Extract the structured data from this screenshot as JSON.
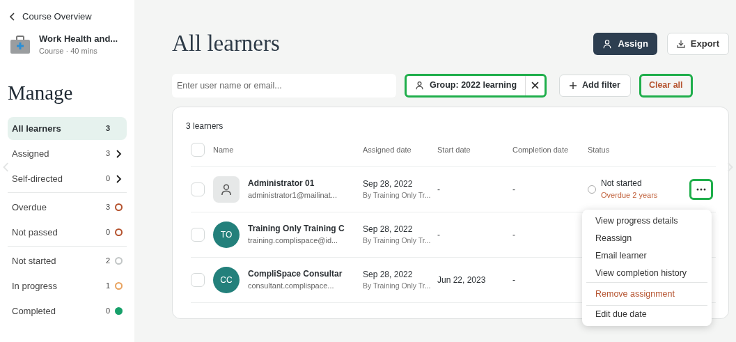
{
  "back_link": "Course Overview",
  "course": {
    "title": "Work Health and...",
    "meta": "Course · 40 mins"
  },
  "sidebar_title": "Manage",
  "sidebar_sections": [
    [
      {
        "label": "All learners",
        "count": "3",
        "kind": "plain",
        "selected": true
      },
      {
        "label": "Assigned",
        "count": "3",
        "kind": "link",
        "selected": false
      },
      {
        "label": "Self-directed",
        "count": "0",
        "kind": "link",
        "selected": false
      }
    ],
    [
      {
        "label": "Overdue",
        "count": "3",
        "kind": "ring",
        "color": "#b5532f",
        "selected": false
      },
      {
        "label": "Not passed",
        "count": "0",
        "kind": "ring",
        "color": "#b5532f",
        "selected": false
      }
    ],
    [
      {
        "label": "Not started",
        "count": "2",
        "kind": "ring",
        "color": "#c2c6c6",
        "selected": false
      },
      {
        "label": "In progress",
        "count": "1",
        "kind": "ring",
        "color": "#e8a25e",
        "selected": false
      },
      {
        "label": "Completed",
        "count": "0",
        "kind": "dot",
        "color": "#17a06a",
        "selected": false
      }
    ]
  ],
  "page_title": "All learners",
  "actions": [
    {
      "label": "Assign",
      "kind": "primary"
    },
    {
      "label": "Export",
      "kind": "secondary"
    }
  ],
  "search": {
    "placeholder": "Enter user name or email..."
  },
  "filter_chip": {
    "label": "Group: 2022 learning",
    "highlighted": true
  },
  "add_filter": "Add filter",
  "clear_all": {
    "label": "Clear all",
    "highlighted": true
  },
  "table": {
    "count": "3 learners",
    "select_all_checked": false,
    "columns": [
      "Name",
      "Assigned date",
      "Start date",
      "Completion date",
      "Status"
    ],
    "rows": [
      {
        "avatar": {
          "kind": "icon"
        },
        "name": "Administrator 01",
        "email": "administrator1@mailinat...",
        "assigned_date": "Sep 28, 2022",
        "assigned_by": "By Training Only Tr...",
        "start_date": "-",
        "completion_date": "-",
        "status": {
          "label": "Not started",
          "note": "Overdue 2 years"
        },
        "menu_highlighted": true,
        "checked": false
      },
      {
        "avatar": {
          "kind": "initials",
          "text": "TO"
        },
        "name": "Training Only Training C",
        "email": "training.complispace@id...",
        "assigned_date": "Sep 28, 2022",
        "assigned_by": "By Training Only Tr...",
        "start_date": "-",
        "completion_date": "-",
        "checked": false
      },
      {
        "avatar": {
          "kind": "initials",
          "text": "CC"
        },
        "name": "CompliSpace Consultar",
        "email": "consultant.complispace...",
        "assigned_date": "Sep 28, 2022",
        "assigned_by": "By Training Only Tr...",
        "start_date": "Jun 22, 2023",
        "completion_date": "-",
        "checked": false
      }
    ]
  },
  "row_menu": [
    [
      {
        "label": "View progress details",
        "kind": "normal"
      },
      {
        "label": "Reassign",
        "kind": "normal"
      },
      {
        "label": "Email learner",
        "kind": "normal"
      },
      {
        "label": "View completion history",
        "kind": "normal"
      }
    ],
    [
      {
        "label": "Remove assignment",
        "kind": "danger"
      }
    ],
    [
      {
        "label": "Edit due date",
        "kind": "normal"
      }
    ]
  ]
}
